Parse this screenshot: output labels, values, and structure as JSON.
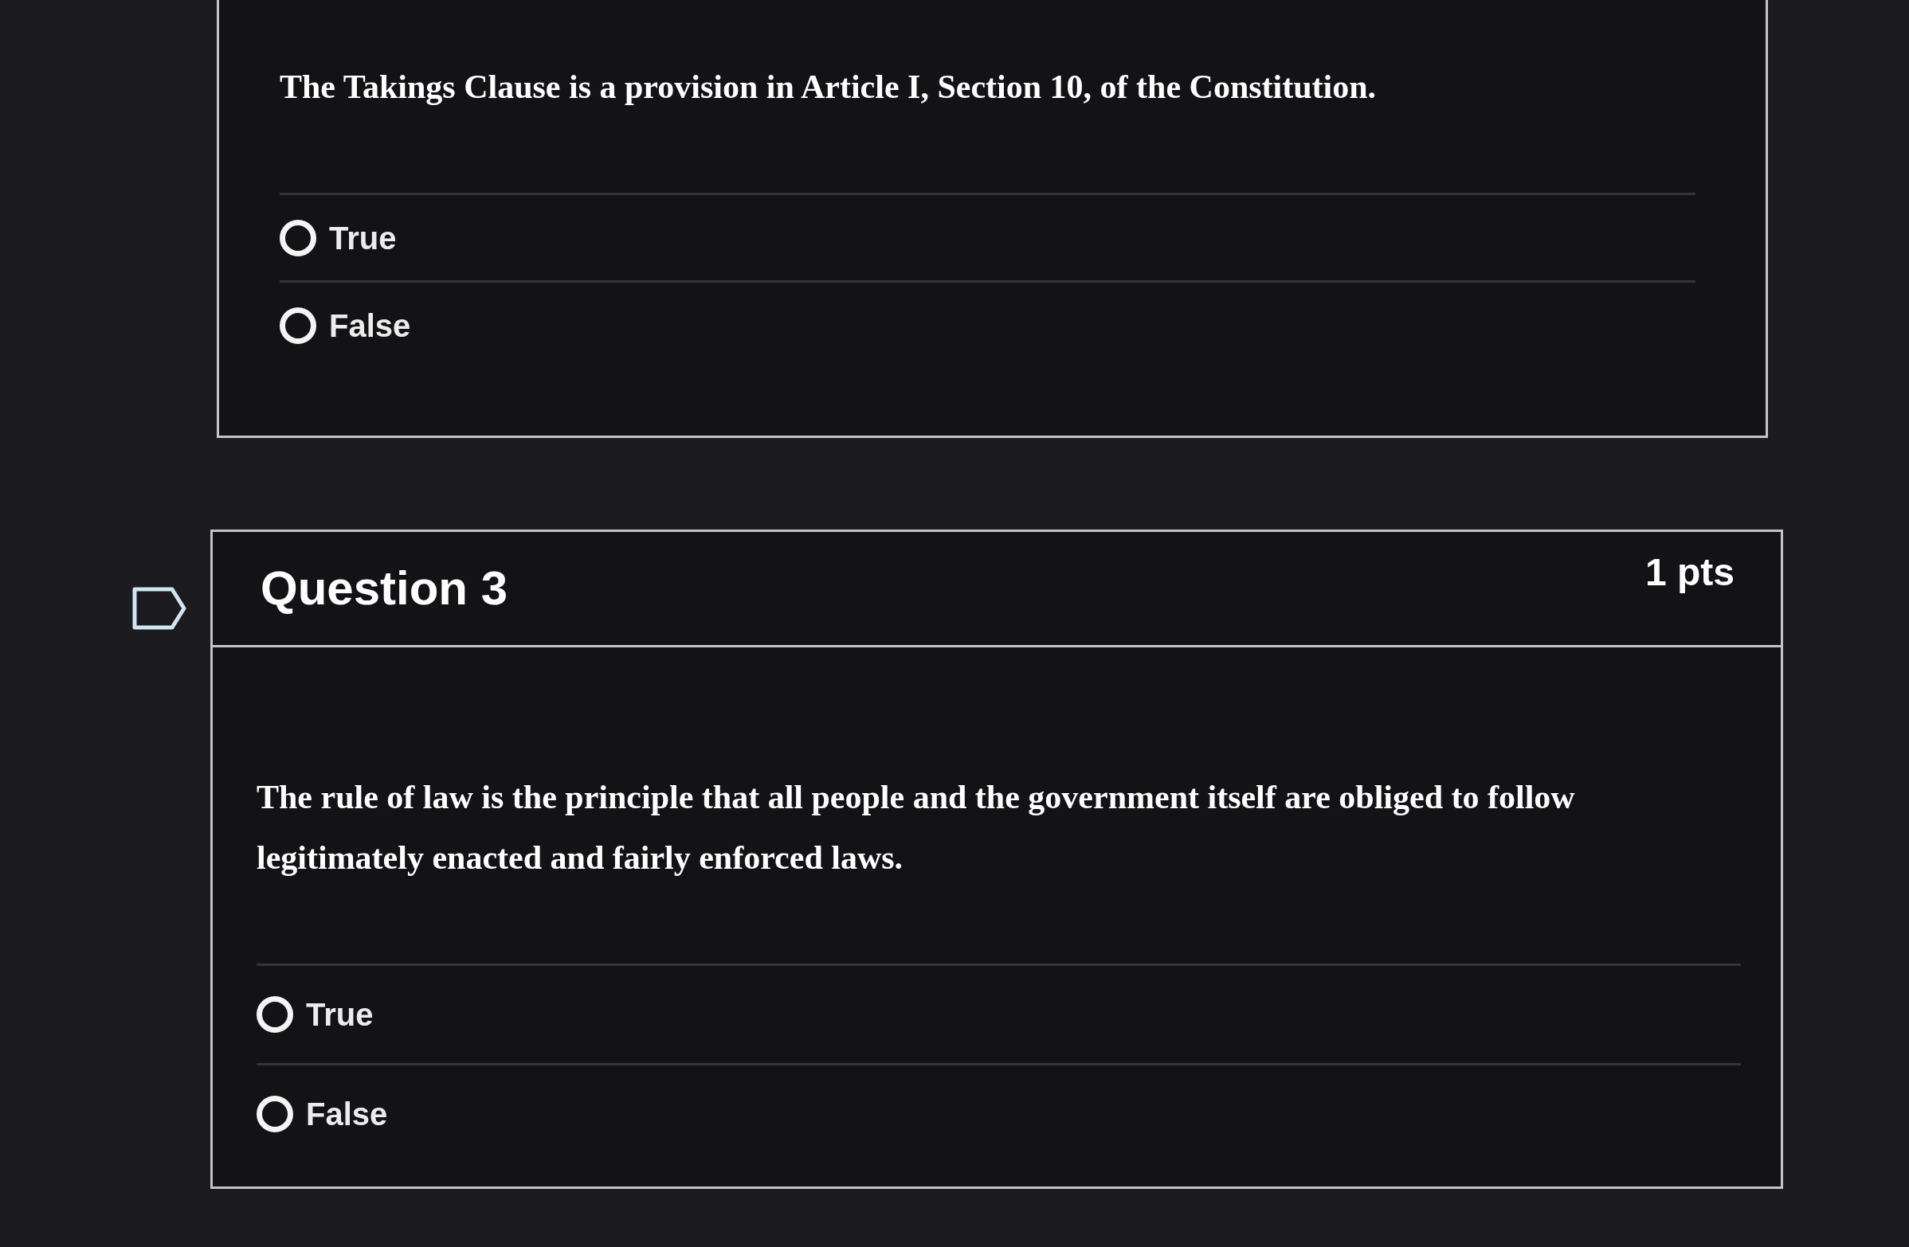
{
  "questions": [
    {
      "text": "The Takings Clause is a provision in Article I, Section 10, of the Constitution.",
      "answers": [
        {
          "label": "True",
          "selected": false
        },
        {
          "label": "False",
          "selected": false
        }
      ]
    },
    {
      "title": "Question 3",
      "points": "1 pts",
      "flagged": false,
      "text": "The rule of law is the principle that all people and the government itself are obliged to follow legitimately enacted and fairly enforced laws.",
      "answers": [
        {
          "label": "True",
          "selected": false
        },
        {
          "label": "False",
          "selected": false
        }
      ]
    }
  ]
}
